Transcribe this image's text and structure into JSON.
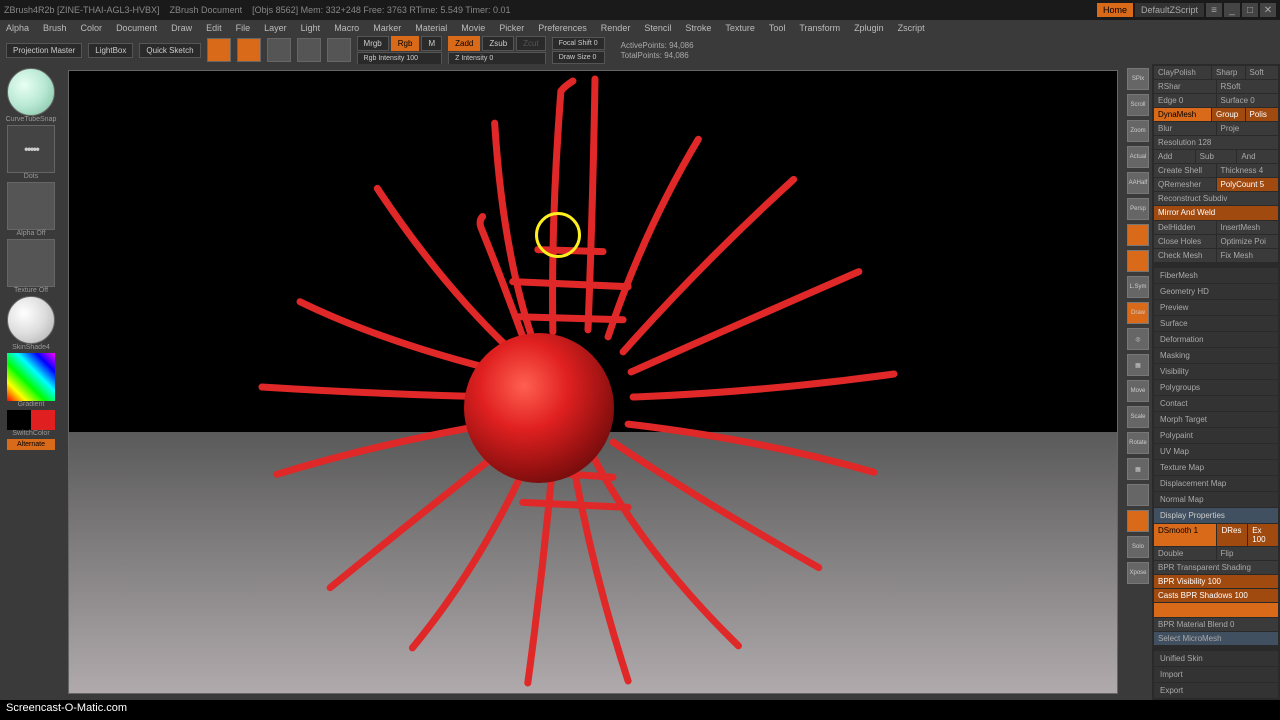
{
  "titlebar": {
    "app": "ZBrush4R2b [ZINE-THAI-AGL3-HVBX]",
    "doc": "ZBrush Document",
    "stats": "[Objs 8562]  Mem: 332+248  Free: 3763  RTime: 5.549  Timer: 0.01",
    "home": "Home",
    "script": "DefaultZScript"
  },
  "menu": {
    "items": [
      "Alpha",
      "Brush",
      "Color",
      "Document",
      "Draw",
      "Edit",
      "File",
      "Layer",
      "Light",
      "Macro",
      "Marker",
      "Material",
      "Movie",
      "Picker",
      "Preferences",
      "Render",
      "Stencil",
      "Stroke",
      "Texture",
      "Tool",
      "Transform",
      "Zplugin",
      "Zscript"
    ]
  },
  "toolbar": {
    "projection": "Projection Master",
    "lightbox": "LightBox",
    "quicksketch": "Quick Sketch",
    "mrgb": "Mrgb",
    "rgb": "Rgb",
    "m": "M",
    "rgb_intensity": "Rgb Intensity 100",
    "zadd": "Zadd",
    "zsub": "Zsub",
    "zcut": "Zcut",
    "z_intensity": "Z Intensity 0",
    "focal": "Focal Shift 0",
    "drawsize": "Draw Size 0",
    "active": "ActivePoints: 94,086",
    "total": "TotalPoints: 94,086"
  },
  "left": {
    "brush": "CurveTubeSnap",
    "dots": "Dots",
    "alpha": "Alpha Off",
    "texture": "Texture Off",
    "material": "SkinShade4",
    "gradient": "Gradient",
    "switch": "SwitchColor",
    "alt": "Alternate"
  },
  "right_icons": [
    "SPix",
    "Scroll",
    "Zoom",
    "Actual",
    "AAHalf",
    "Persp",
    "Floor",
    "L.Sym",
    "Draw",
    "Frame",
    "Move",
    "Scale",
    "Rotate",
    "PF",
    "Solo",
    "Xpose"
  ],
  "right_panel": {
    "top": {
      "claypolish": "ClayPolish",
      "sharp": "Sharp",
      "soft": "Soft",
      "rshar": "RShar",
      "rsoft": "RSoft",
      "edge0": "Edge 0",
      "surface0": "Surface 0",
      "dynamesh": "DynaMesh",
      "group": "Group",
      "polis": "Polis",
      "blur": "Blur",
      "proje": "Proje",
      "resolution": "Resolution 128",
      "add": "Add",
      "sub": "Sub",
      "and": "And",
      "createshell": "Create Shell",
      "thickness": "Thickness 4",
      "qremesher": "QRemesher",
      "polycount": "PolyCount 5",
      "reconstruct": "Reconstruct Subdiv",
      "mirror": "Mirror And Weld",
      "delhidden": "DelHidden",
      "insertmesh": "InsertMesh",
      "closeholes": "Close Holes",
      "optimize": "Optimize Poi",
      "checkmesh": "Check Mesh",
      "fixmesh": "Fix Mesh"
    },
    "sections": [
      "FiberMesh",
      "Geometry HD",
      "Preview",
      "Surface",
      "Deformation",
      "Masking",
      "Visibility",
      "Polygroups",
      "Contact",
      "Morph Target",
      "Polypaint",
      "UV Map",
      "Texture Map",
      "Displacement Map",
      "Normal Map"
    ],
    "display": {
      "title": "Display Properties",
      "dsmooth": "DSmooth 1",
      "dres": "DRes",
      "ex": "Ex 100",
      "double": "Double",
      "flip": "Flip",
      "bpr_trans": "BPR Transparent Shading",
      "bpr_vis": "BPR Visibility 100",
      "bpr_shadows": "Casts BPR Shadows 100",
      "bpr_blend": "BPR Material Blend 0",
      "select_micro": "Select MicroMesh"
    },
    "bottom": [
      "Unified Skin",
      "Import",
      "Export"
    ]
  },
  "watermark": "Screencast-O-Matic.com"
}
